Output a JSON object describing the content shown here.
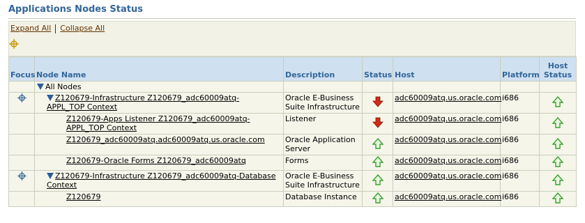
{
  "header": {
    "title": "Applications Nodes Status"
  },
  "toolbar": {
    "expand_all": "Expand All",
    "collapse_all": "Collapse All"
  },
  "columns": {
    "focus": "Focus",
    "node_name": "Node Name",
    "description": "Description",
    "status": "Status",
    "host": "Host",
    "platform": "Platform",
    "host_status_line1": "Host",
    "host_status_line2": "Status"
  },
  "tree": {
    "all_nodes": "All Nodes",
    "rows": [
      {
        "name_line1": "Z120679-Infrastructure Z120679_adc60009atq-",
        "name_line2": "APPL_TOP Context",
        "desc_line1": "Oracle E-Business",
        "desc_line2": "Suite Infrastructure",
        "status": "down",
        "host": "adc60009atq.us.oracle.com",
        "platform": "i686",
        "host_status": "up"
      },
      {
        "name_line1": "Z120679-Apps Listener Z120679_adc60009atq-",
        "name_line2": "APPL_TOP Context",
        "desc_line1": "Listener",
        "status": "down",
        "host": "adc60009atq.us.oracle.com",
        "platform": "i686",
        "host_status": "up"
      },
      {
        "name_line1": "Z120679_adc60009atq.adc60009atq.us.oracle.com",
        "desc_line1": "Oracle Application",
        "desc_line2": "Server",
        "status": "up",
        "host": "adc60009atq.us.oracle.com",
        "platform": "i686",
        "host_status": "up"
      },
      {
        "name_line1": "Z120679-Oracle Forms Z120679_adc60009atq",
        "desc_line1": "Forms",
        "status": "up",
        "host": "adc60009atq.us.oracle.com",
        "platform": "i686",
        "host_status": "up"
      },
      {
        "name_line1": "Z120679-Infrastructure Z120679_adc60009atq-Database",
        "name_line2": "Context",
        "desc_line1": "Oracle E-Business",
        "desc_line2": "Suite Infrastructure",
        "status": "up",
        "host": "adc60009atq.us.oracle.com",
        "platform": "i686",
        "host_status": "up"
      },
      {
        "name_line1": "Z120679",
        "desc_line1": "Database Instance",
        "status": "up",
        "host": "adc60009atq.us.oracle.com",
        "platform": "i686",
        "host_status": "up"
      }
    ]
  },
  "colors": {
    "title": "#336699",
    "header_bg": "#cfe0f1",
    "row_bg": "#f5f5ea",
    "up": "#3aa12f",
    "down": "#d52a16"
  },
  "icons": {
    "focus": "crosshair-icon",
    "up": "up-arrow-icon",
    "down": "down-arrow-icon",
    "expanded": "expand-triangle-icon"
  }
}
